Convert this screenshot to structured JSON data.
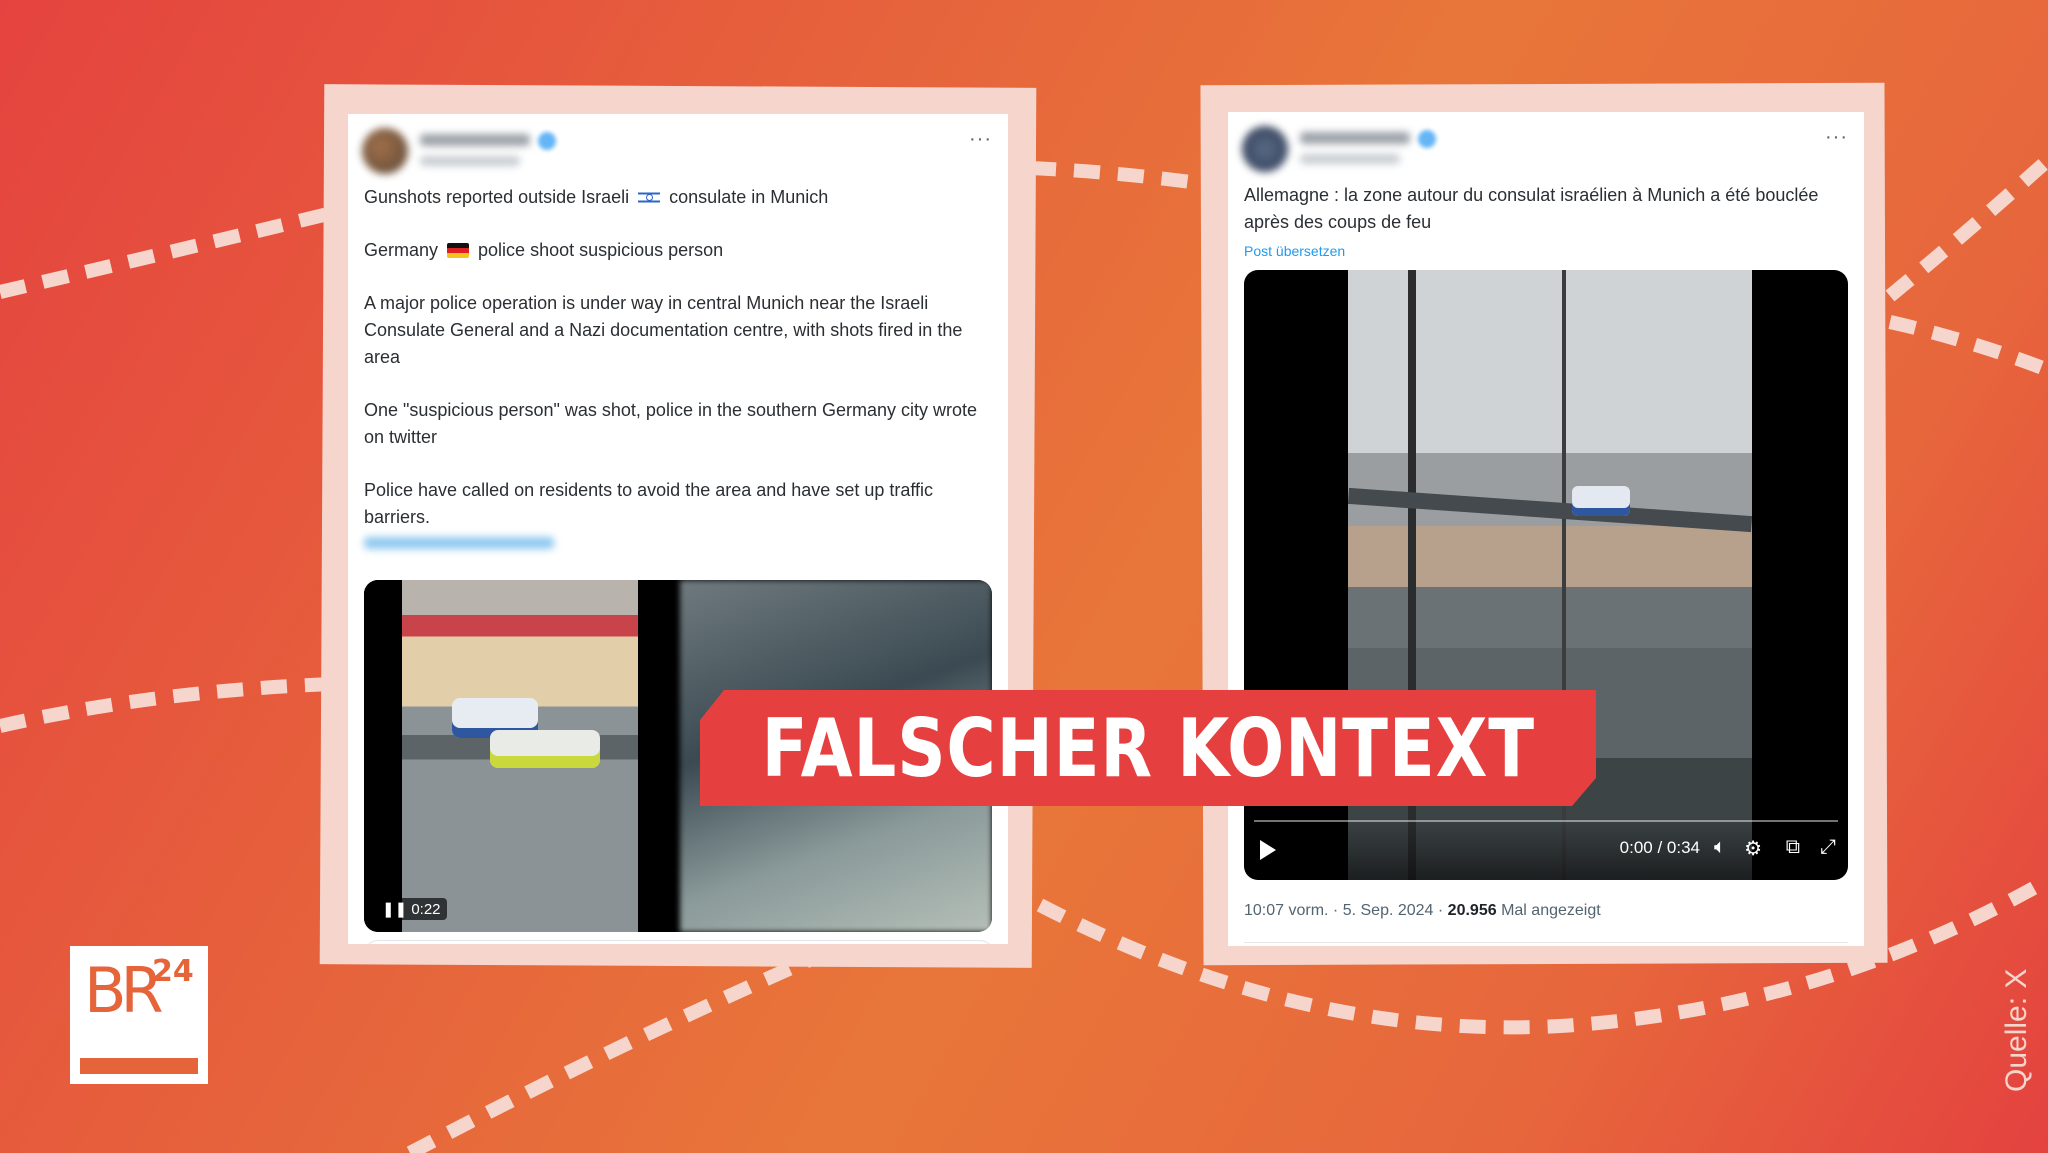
{
  "background": {
    "gradient_colors": [
      "#e5433f",
      "#e8763a",
      "#e4423f"
    ],
    "dash_color": "#f6d6cc"
  },
  "left_tweet": {
    "author_blurred": true,
    "more_label": "···",
    "paragraphs": [
      {
        "before_flag": "Gunshots reported outside Israeli",
        "flag": "israel-flag",
        "after_flag": "consulate in Munich"
      },
      {
        "before_flag": "Germany",
        "flag": "germany-flag",
        "after_flag": "police shoot suspicious person"
      }
    ],
    "body": [
      "A major police operation is under way in central Munich near the Israeli Consulate General and a Nazi documentation centre, with shots fired in the area",
      "One \"suspicious person\" was shot, police in the southern Germany city wrote on twitter",
      "Police have called on residents to avoid the area and have set up traffic barriers."
    ],
    "link_blurred": true,
    "video_time": "0:22",
    "video_state_icon": "pause-icon"
  },
  "right_tweet": {
    "author_blurred": true,
    "more_label": "···",
    "text": "Allemagne : la zone autour du consulat israélien à Munich a été bouclée après des coups de feu",
    "translate_label": "Post übersetzen",
    "video": {
      "time": "0:00 / 0:34",
      "progress": 0,
      "icons": [
        "play-icon",
        "volume-icon",
        "settings-icon",
        "picture-in-picture-icon",
        "fullscreen-icon"
      ]
    },
    "timestamp": "10:07 vorm. · 5. Sep. 2024 ·",
    "views_count": "20.956",
    "views_label": "Mal angezeigt"
  },
  "banner": {
    "label": "FALSCHER KONTEXT",
    "color": "#e5403f"
  },
  "logo": {
    "text": "BR",
    "superscript": "24",
    "color": "#e5643a"
  },
  "source_label": "Quelle: X"
}
